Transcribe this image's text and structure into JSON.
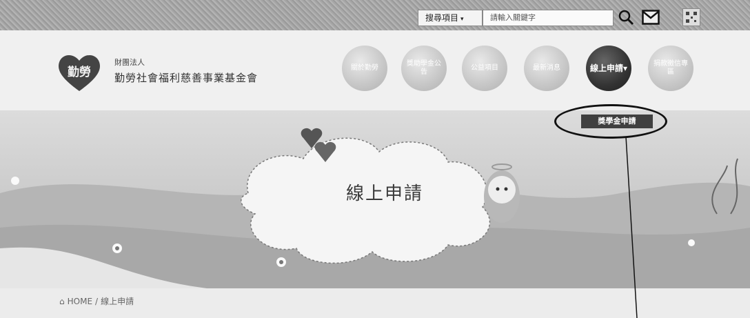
{
  "topbar": {
    "search_select_label": "搜尋項目",
    "search_placeholder": "請輸入關鍵字"
  },
  "header": {
    "org_small": "財團法人",
    "org_name": "勤勞社會福利慈善事業基金會",
    "logo_text": "勤勞"
  },
  "nav": {
    "items": [
      {
        "label": "關於勤勞"
      },
      {
        "label": "獎助學金公告"
      },
      {
        "label": "公益項目"
      },
      {
        "label": "最新消息"
      },
      {
        "label": "線上申請"
      },
      {
        "label": "捐款徵信專區"
      }
    ],
    "active_index": 4,
    "dropdown_item": "獎學金申請"
  },
  "banner": {
    "title": "線上申請"
  },
  "breadcrumb": {
    "home": "HOME",
    "separator": "/",
    "current": "線上申請"
  },
  "colors": {
    "nav_inactive": "#c6c6c6",
    "nav_active": "#333333",
    "dropdown_bg": "#404040"
  }
}
